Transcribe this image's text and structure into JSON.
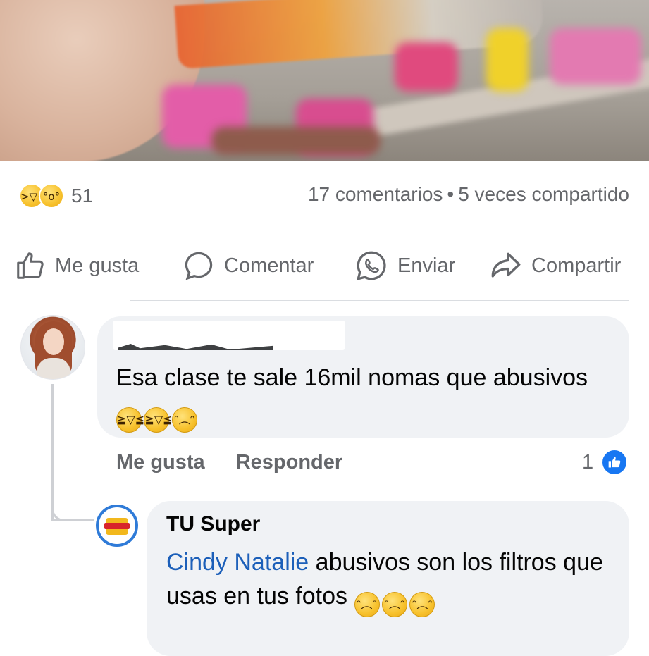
{
  "post": {
    "reactions": {
      "icons": [
        "laugh-emoji-icon",
        "wow-emoji-icon"
      ],
      "count": "51"
    },
    "comments_count": "17 comentarios",
    "separator": "•",
    "shares_count": "5 veces compartido"
  },
  "actions": {
    "like": "Me gusta",
    "comment": "Comentar",
    "send": "Enviar",
    "share": "Compartir"
  },
  "comment": {
    "text": "Esa clase te sale 16mil nomas que abusivos",
    "emojis": [
      "rofl-emoji-icon",
      "rofl-emoji-icon",
      "pleading-emoji-icon"
    ],
    "like_label": "Me gusta",
    "reply_label": "Responder",
    "like_count": "1"
  },
  "reply": {
    "author": "TU Super",
    "mention": "Cindy Natalie",
    "text": " abusivos son los filtros que usas en tus fotos",
    "emojis": [
      "pleading-emoji-icon",
      "pleading-emoji-icon",
      "pleading-emoji-icon"
    ]
  },
  "colors": {
    "text_primary": "#050505",
    "text_secondary": "#65676b",
    "bubble_bg": "#f0f2f5",
    "accent_blue": "#1877f2",
    "mention_blue": "#1c5fb9"
  }
}
